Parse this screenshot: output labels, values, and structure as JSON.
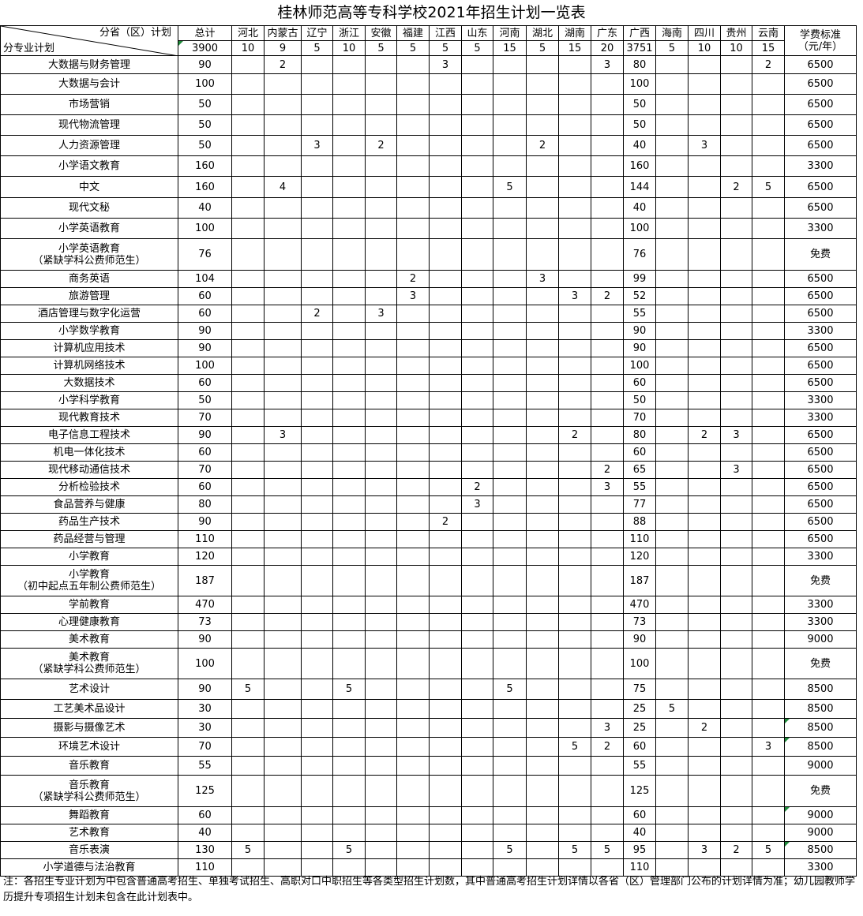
{
  "title": "桂林师范高等专科学校2021年招生计划一览表",
  "header": {
    "corner_top": "分省（区）计划",
    "corner_bottom": "分专业计划",
    "total_label": "总计",
    "fee_label_line1": "学费标准",
    "fee_label_line2": "（元/年）",
    "total_value": "3900",
    "provinces": [
      {
        "name": "河北",
        "count": "10"
      },
      {
        "name": "内蒙古",
        "count": "9"
      },
      {
        "name": "辽宁",
        "count": "5"
      },
      {
        "name": "浙江",
        "count": "10"
      },
      {
        "name": "安徽",
        "count": "5"
      },
      {
        "name": "福建",
        "count": "5"
      },
      {
        "name": "江西",
        "count": "5"
      },
      {
        "name": "山东",
        "count": "5"
      },
      {
        "name": "河南",
        "count": "15"
      },
      {
        "name": "湖北",
        "count": "5"
      },
      {
        "name": "湖南",
        "count": "15"
      },
      {
        "name": "广东",
        "count": "20"
      },
      {
        "name": "广西",
        "count": "3751"
      },
      {
        "name": "海南",
        "count": "5"
      },
      {
        "name": "四川",
        "count": "10"
      },
      {
        "name": "贵州",
        "count": "10"
      },
      {
        "name": "云南",
        "count": "15"
      }
    ]
  },
  "rows": [
    {
      "name": [
        "大数据与财务管理"
      ],
      "total": "90",
      "cells": [
        "",
        "2",
        "",
        "",
        "",
        "",
        "3",
        "",
        "",
        "",
        "",
        "3",
        "80",
        "",
        "",
        "",
        "2"
      ],
      "fee": "6500"
    },
    {
      "name": [
        "大数据与会计"
      ],
      "total": "100",
      "cells": [
        "",
        "",
        "",
        "",
        "",
        "",
        "",
        "",
        "",
        "",
        "",
        "",
        "100",
        "",
        "",
        "",
        ""
      ],
      "fee": "6500"
    },
    {
      "name": [
        "市场营销"
      ],
      "total": "50",
      "cells": [
        "",
        "",
        "",
        "",
        "",
        "",
        "",
        "",
        "",
        "",
        "",
        "",
        "50",
        "",
        "",
        "",
        ""
      ],
      "fee": "6500"
    },
    {
      "name": [
        "现代物流管理"
      ],
      "total": "50",
      "cells": [
        "",
        "",
        "",
        "",
        "",
        "",
        "",
        "",
        "",
        "",
        "",
        "",
        "50",
        "",
        "",
        "",
        ""
      ],
      "fee": "6500"
    },
    {
      "name": [
        "人力资源管理"
      ],
      "total": "50",
      "cells": [
        "",
        "",
        "3",
        "",
        "2",
        "",
        "",
        "",
        "",
        "2",
        "",
        "",
        "40",
        "",
        "3",
        "",
        ""
      ],
      "fee": "6500"
    },
    {
      "name": [
        "小学语文教育"
      ],
      "total": "160",
      "cells": [
        "",
        "",
        "",
        "",
        "",
        "",
        "",
        "",
        "",
        "",
        "",
        "",
        "160",
        "",
        "",
        "",
        ""
      ],
      "fee": "3300"
    },
    {
      "name": [
        "中文"
      ],
      "total": "160",
      "cells": [
        "",
        "4",
        "",
        "",
        "",
        "",
        "",
        "",
        "5",
        "",
        "",
        "",
        "144",
        "",
        "",
        "2",
        "5"
      ],
      "fee": "6500"
    },
    {
      "name": [
        "现代文秘"
      ],
      "total": "40",
      "cells": [
        "",
        "",
        "",
        "",
        "",
        "",
        "",
        "",
        "",
        "",
        "",
        "",
        "40",
        "",
        "",
        "",
        ""
      ],
      "fee": "6500"
    },
    {
      "name": [
        "小学英语教育"
      ],
      "total": "100",
      "cells": [
        "",
        "",
        "",
        "",
        "",
        "",
        "",
        "",
        "",
        "",
        "",
        "",
        "100",
        "",
        "",
        "",
        ""
      ],
      "fee": "3300"
    },
    {
      "name": [
        "小学英语教育",
        "（紧缺学科公费师范生）"
      ],
      "total": "76",
      "cells": [
        "",
        "",
        "",
        "",
        "",
        "",
        "",
        "",
        "",
        "",
        "",
        "",
        "76",
        "",
        "",
        "",
        ""
      ],
      "fee": "免费"
    },
    {
      "name": [
        "商务英语"
      ],
      "total": "104",
      "cells": [
        "",
        "",
        "",
        "",
        "",
        "2",
        "",
        "",
        "",
        "3",
        "",
        "",
        "99",
        "",
        "",
        "",
        ""
      ],
      "fee": "6500"
    },
    {
      "name": [
        "旅游管理"
      ],
      "total": "60",
      "cells": [
        "",
        "",
        "",
        "",
        "",
        "3",
        "",
        "",
        "",
        "",
        "3",
        "2",
        "52",
        "",
        "",
        "",
        ""
      ],
      "fee": "6500"
    },
    {
      "name": [
        "酒店管理与数字化运营"
      ],
      "total": "60",
      "cells": [
        "",
        "",
        "2",
        "",
        "3",
        "",
        "",
        "",
        "",
        "",
        "",
        "",
        "55",
        "",
        "",
        "",
        ""
      ],
      "fee": "6500"
    },
    {
      "name": [
        "小学数学教育"
      ],
      "total": "90",
      "cells": [
        "",
        "",
        "",
        "",
        "",
        "",
        "",
        "",
        "",
        "",
        "",
        "",
        "90",
        "",
        "",
        "",
        ""
      ],
      "fee": "3300"
    },
    {
      "name": [
        "计算机应用技术"
      ],
      "total": "90",
      "cells": [
        "",
        "",
        "",
        "",
        "",
        "",
        "",
        "",
        "",
        "",
        "",
        "",
        "90",
        "",
        "",
        "",
        ""
      ],
      "fee": "6500"
    },
    {
      "name": [
        "计算机网络技术"
      ],
      "total": "100",
      "cells": [
        "",
        "",
        "",
        "",
        "",
        "",
        "",
        "",
        "",
        "",
        "",
        "",
        "100",
        "",
        "",
        "",
        ""
      ],
      "fee": "6500"
    },
    {
      "name": [
        "大数据技术"
      ],
      "total": "60",
      "cells": [
        "",
        "",
        "",
        "",
        "",
        "",
        "",
        "",
        "",
        "",
        "",
        "",
        "60",
        "",
        "",
        "",
        ""
      ],
      "fee": "6500"
    },
    {
      "name": [
        "小学科学教育"
      ],
      "total": "50",
      "cells": [
        "",
        "",
        "",
        "",
        "",
        "",
        "",
        "",
        "",
        "",
        "",
        "",
        "50",
        "",
        "",
        "",
        ""
      ],
      "fee": "3300"
    },
    {
      "name": [
        "现代教育技术"
      ],
      "total": "70",
      "cells": [
        "",
        "",
        "",
        "",
        "",
        "",
        "",
        "",
        "",
        "",
        "",
        "",
        "70",
        "",
        "",
        "",
        ""
      ],
      "fee": "3300"
    },
    {
      "name": [
        "电子信息工程技术"
      ],
      "total": "90",
      "cells": [
        "",
        "3",
        "",
        "",
        "",
        "",
        "",
        "",
        "",
        "",
        "2",
        "",
        "80",
        "",
        "2",
        "3",
        ""
      ],
      "fee": "6500"
    },
    {
      "name": [
        "机电一体化技术"
      ],
      "total": "60",
      "cells": [
        "",
        "",
        "",
        "",
        "",
        "",
        "",
        "",
        "",
        "",
        "",
        "",
        "60",
        "",
        "",
        "",
        ""
      ],
      "fee": "6500"
    },
    {
      "name": [
        "现代移动通信技术"
      ],
      "total": "70",
      "cells": [
        "",
        "",
        "",
        "",
        "",
        "",
        "",
        "",
        "",
        "",
        "",
        "2",
        "65",
        "",
        "",
        "3",
        ""
      ],
      "fee": "6500"
    },
    {
      "name": [
        "分析检验技术"
      ],
      "total": "60",
      "cells": [
        "",
        "",
        "",
        "",
        "",
        "",
        "",
        "2",
        "",
        "",
        "",
        "3",
        "55",
        "",
        "",
        "",
        ""
      ],
      "fee": "6500"
    },
    {
      "name": [
        "食品营养与健康"
      ],
      "total": "80",
      "cells": [
        "",
        "",
        "",
        "",
        "",
        "",
        "",
        "3",
        "",
        "",
        "",
        "",
        "77",
        "",
        "",
        "",
        ""
      ],
      "fee": "6500"
    },
    {
      "name": [
        "药品生产技术"
      ],
      "total": "90",
      "cells": [
        "",
        "",
        "",
        "",
        "",
        "",
        "2",
        "",
        "",
        "",
        "",
        "",
        "88",
        "",
        "",
        "",
        ""
      ],
      "fee": "6500"
    },
    {
      "name": [
        "药品经营与管理"
      ],
      "total": "110",
      "cells": [
        "",
        "",
        "",
        "",
        "",
        "",
        "",
        "",
        "",
        "",
        "",
        "",
        "110",
        "",
        "",
        "",
        ""
      ],
      "fee": "6500"
    },
    {
      "name": [
        "小学教育"
      ],
      "total": "120",
      "cells": [
        "",
        "",
        "",
        "",
        "",
        "",
        "",
        "",
        "",
        "",
        "",
        "",
        "120",
        "",
        "",
        "",
        ""
      ],
      "fee": "3300"
    },
    {
      "name": [
        "小学教育",
        "（初中起点五年制公费师范生）"
      ],
      "total": "187",
      "cells": [
        "",
        "",
        "",
        "",
        "",
        "",
        "",
        "",
        "",
        "",
        "",
        "",
        "187",
        "",
        "",
        "",
        ""
      ],
      "fee": "免费"
    },
    {
      "name": [
        "学前教育"
      ],
      "total": "470",
      "cells": [
        "",
        "",
        "",
        "",
        "",
        "",
        "",
        "",
        "",
        "",
        "",
        "",
        "470",
        "",
        "",
        "",
        ""
      ],
      "fee": "3300"
    },
    {
      "name": [
        "心理健康教育"
      ],
      "total": "73",
      "cells": [
        "",
        "",
        "",
        "",
        "",
        "",
        "",
        "",
        "",
        "",
        "",
        "",
        "73",
        "",
        "",
        "",
        ""
      ],
      "fee": "3300"
    },
    {
      "name": [
        "美术教育"
      ],
      "total": "90",
      "cells": [
        "",
        "",
        "",
        "",
        "",
        "",
        "",
        "",
        "",
        "",
        "",
        "",
        "90",
        "",
        "",
        "",
        ""
      ],
      "fee": "9000"
    },
    {
      "name": [
        "美术教育",
        "（紧缺学科公费师范生）"
      ],
      "total": "100",
      "cells": [
        "",
        "",
        "",
        "",
        "",
        "",
        "",
        "",
        "",
        "",
        "",
        "",
        "100",
        "",
        "",
        "",
        ""
      ],
      "fee": "免费"
    },
    {
      "name": [
        "艺术设计"
      ],
      "total": "90",
      "cells": [
        "5",
        "",
        "",
        "5",
        "",
        "",
        "",
        "",
        "5",
        "",
        "",
        "",
        "75",
        "",
        "",
        "",
        ""
      ],
      "fee": "8500"
    },
    {
      "name": [
        "工艺美术品设计"
      ],
      "total": "30",
      "cells": [
        "",
        "",
        "",
        "",
        "",
        "",
        "",
        "",
        "",
        "",
        "",
        "",
        "25",
        "5",
        "",
        "",
        ""
      ],
      "fee": "8500"
    },
    {
      "name": [
        "摄影与摄像艺术"
      ],
      "total": "30",
      "cells": [
        "",
        "",
        "",
        "",
        "",
        "",
        "",
        "",
        "",
        "",
        "",
        "3",
        "25",
        "",
        "2",
        "",
        ""
      ],
      "fee": "8500"
    },
    {
      "name": [
        "环境艺术设计"
      ],
      "total": "70",
      "cells": [
        "",
        "",
        "",
        "",
        "",
        "",
        "",
        "",
        "",
        "",
        "5",
        "2",
        "60",
        "",
        "",
        "",
        "3"
      ],
      "fee": "8500"
    },
    {
      "name": [
        "音乐教育"
      ],
      "total": "55",
      "cells": [
        "",
        "",
        "",
        "",
        "",
        "",
        "",
        "",
        "",
        "",
        "",
        "",
        "55",
        "",
        "",
        "",
        ""
      ],
      "fee": "9000"
    },
    {
      "name": [
        "音乐教育",
        "（紧缺学科公费师范生）"
      ],
      "total": "125",
      "cells": [
        "",
        "",
        "",
        "",
        "",
        "",
        "",
        "",
        "",
        "",
        "",
        "",
        "125",
        "",
        "",
        "",
        ""
      ],
      "fee": "免费"
    },
    {
      "name": [
        "舞蹈教育"
      ],
      "total": "60",
      "cells": [
        "",
        "",
        "",
        "",
        "",
        "",
        "",
        "",
        "",
        "",
        "",
        "",
        "60",
        "",
        "",
        "",
        ""
      ],
      "fee": "9000"
    },
    {
      "name": [
        "艺术教育"
      ],
      "total": "40",
      "cells": [
        "",
        "",
        "",
        "",
        "",
        "",
        "",
        "",
        "",
        "",
        "",
        "",
        "40",
        "",
        "",
        "",
        ""
      ],
      "fee": "9000"
    },
    {
      "name": [
        "音乐表演"
      ],
      "total": "130",
      "cells": [
        "5",
        "",
        "",
        "5",
        "",
        "",
        "",
        "",
        "5",
        "",
        "5",
        "5",
        "95",
        "",
        "3",
        "2",
        "5"
      ],
      "fee": "8500"
    },
    {
      "name": [
        "小学道德与法治教育"
      ],
      "total": "110",
      "cells": [
        "",
        "",
        "",
        "",
        "",
        "",
        "",
        "",
        "",
        "",
        "",
        "",
        "110",
        "",
        "",
        "",
        ""
      ],
      "fee": "3300"
    }
  ],
  "note": "注：各招生专业计划为中包含普通高考招生、单独考试招生、高职对口中职招生等各类型招生计划数，其中普通高考招生计划详情以各省（区）管理部门公布的计划详情为准；幼儿园教师学历提升专项招生计划未包含在此计划表中。",
  "colors": {
    "border": "#000000",
    "marker": "#1f8a3a"
  }
}
